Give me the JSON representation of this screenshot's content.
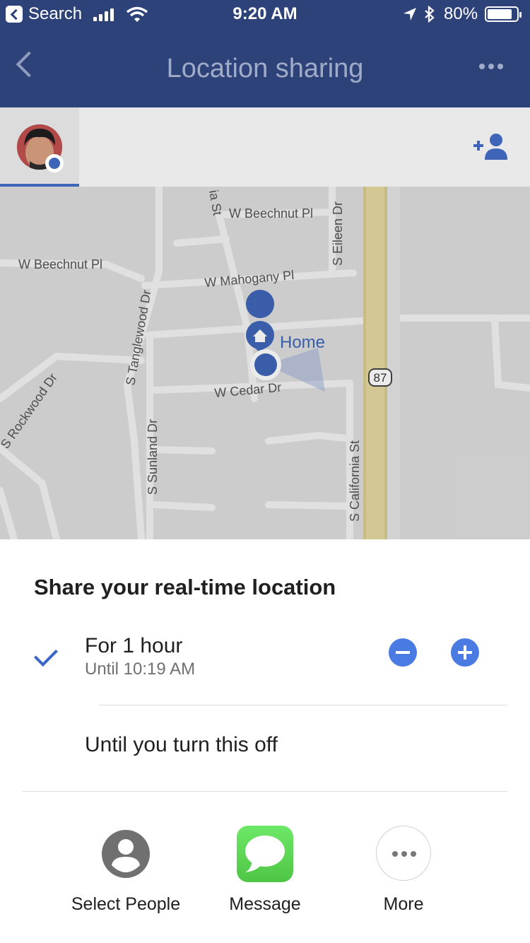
{
  "status_bar": {
    "back_label": "Search",
    "time": "9:20 AM",
    "battery": "80%"
  },
  "app_bar": {
    "title": "Location sharing"
  },
  "map": {
    "home_label": "Home",
    "highway": "87",
    "streets": {
      "beechnut_top": "W Beechnut Pl",
      "beechnut_left": "W Beechnut Pl",
      "mahogany": "W Mahogany Pl",
      "eileen": "S Eileen Dr",
      "tanglewood": "S Tanglewood Dr",
      "cedar": "W Cedar Dr",
      "rockwood": "S Rockwood Dr",
      "sunland": "S Sunland Dr",
      "california": "S California St",
      "cut_top": "ia St"
    }
  },
  "sheet": {
    "title": "Share your real-time location",
    "option1_title": "For 1 hour",
    "option1_sub": "Until 10:19 AM",
    "option2": "Until you turn this off",
    "share_targets": [
      "Select People",
      "Message",
      "More"
    ]
  },
  "colors": {
    "header": "#2d4279",
    "accent": "#3f65b8",
    "button_blue": "#4a7be3",
    "message_green": "#5fd45a"
  },
  "icons": [
    "back-icon",
    "more-dots-icon",
    "add-person-icon",
    "home-icon",
    "checkmark-icon",
    "minus-icon",
    "plus-icon",
    "person-icon",
    "message-icon",
    "more-icon"
  ]
}
